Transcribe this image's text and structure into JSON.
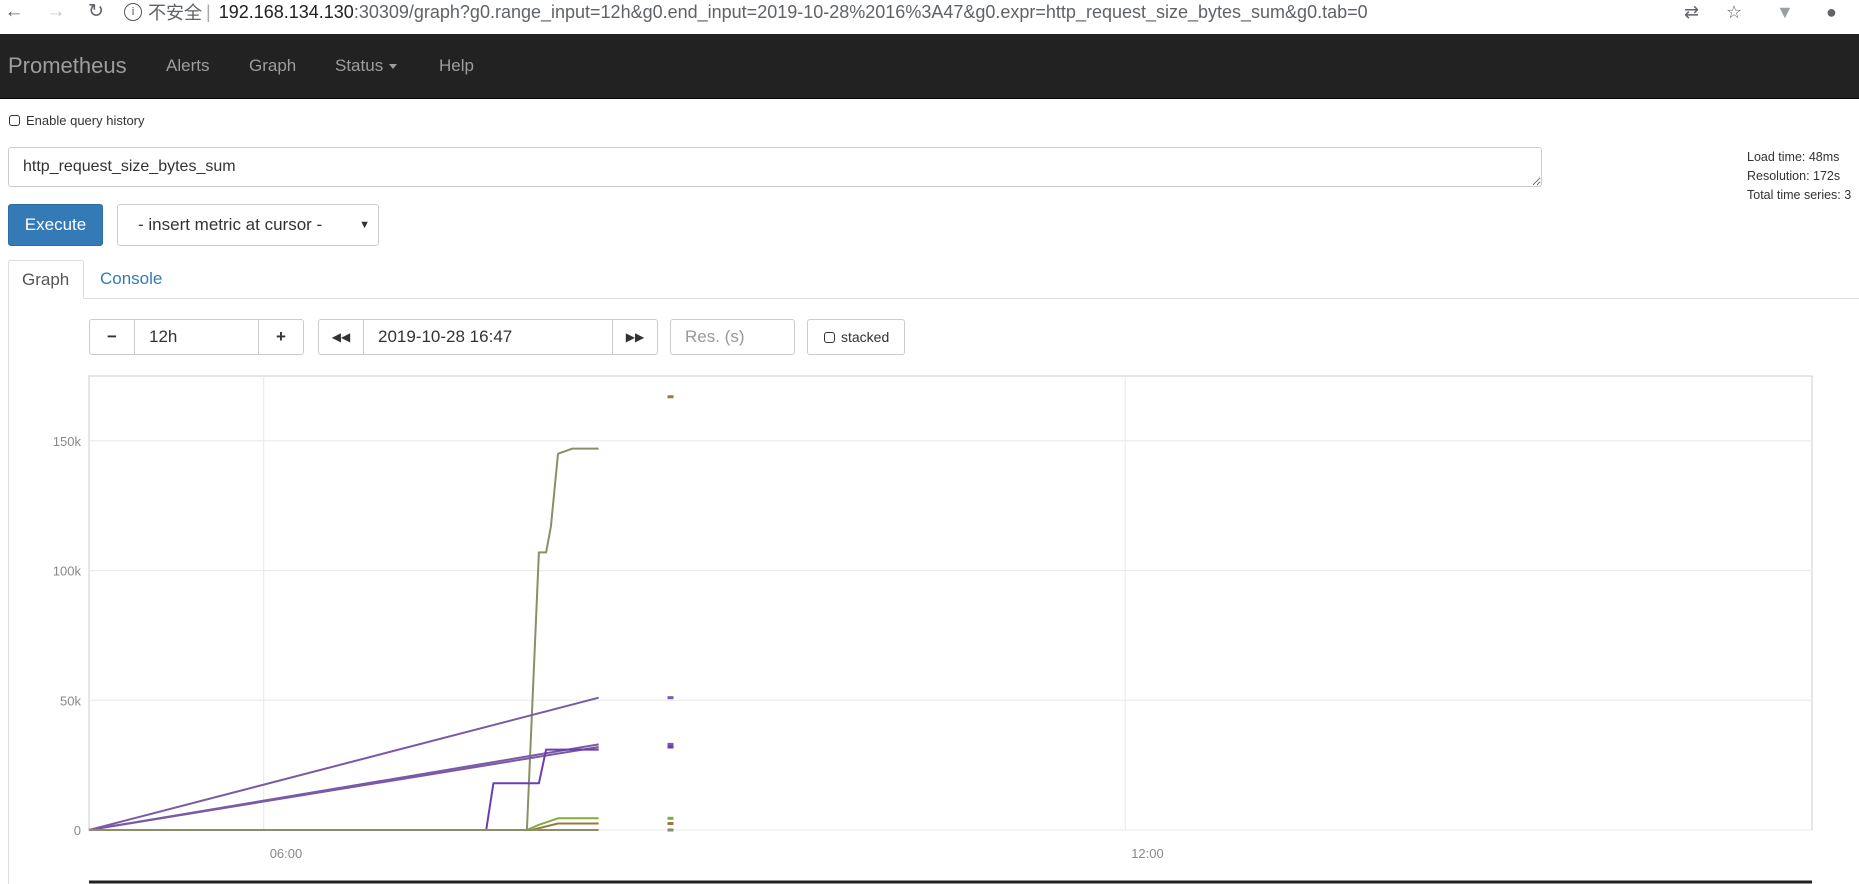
{
  "browser": {
    "back_icon": "arrow-left-icon",
    "forward_icon": "arrow-right-icon",
    "reload_icon": "reload-icon",
    "security_label": "不安全",
    "url_host": "192.168.134.130",
    "url_rest": ":30309/graph?g0.range_input=12h&g0.end_input=2019-10-28%2016%3A47&g0.expr=http_request_size_bytes_sum&g0.tab=0"
  },
  "navbar": {
    "brand": "Prometheus",
    "items": [
      {
        "label": "Alerts"
      },
      {
        "label": "Graph"
      },
      {
        "label": "Status"
      },
      {
        "label": "Help"
      }
    ]
  },
  "query": {
    "history_label": "Enable query history",
    "expression": "http_request_size_bytes_sum",
    "execute_label": "Execute",
    "insert_metric_label": "- insert metric at cursor -"
  },
  "stats": {
    "load_time": "Load time: 48ms",
    "resolution": "Resolution: 172s",
    "total_series": "Total time series: 3"
  },
  "tabs": [
    {
      "label": "Graph",
      "active": true
    },
    {
      "label": "Console",
      "active": false
    }
  ],
  "graph_controls": {
    "minus_label": "−",
    "range_value": "12h",
    "plus_label": "+",
    "back_label": "◀◀",
    "end_time": "2019-10-28 16:47",
    "forward_label": "▶▶",
    "resolution_placeholder": "Res. (s)",
    "stacked_label": "stacked"
  },
  "chart_data": {
    "type": "line",
    "x_type": "time",
    "x_range": [
      "04:47",
      "16:47"
    ],
    "x_ticks": [
      "06:00",
      "12:00"
    ],
    "y_ticks": [
      "0",
      "50k",
      "100k",
      "150k"
    ],
    "ylim": [
      0,
      175000
    ],
    "grid": true,
    "colors": {
      "olive": "#8a8f66",
      "violet": "#7a5aa6",
      "purple": "#6a3db3",
      "green": "#7fae3f",
      "brown": "#9a7a3a"
    },
    "series": [
      {
        "color": "olive",
        "points": [
          [
            "04:47",
            0
          ],
          [
            "07:35",
            0
          ],
          [
            "07:50",
            0
          ],
          [
            "07:55",
            107000
          ],
          [
            "07:58",
            107000
          ],
          [
            "08:00",
            117000
          ],
          [
            "08:03",
            145000
          ],
          [
            "08:06",
            146000
          ],
          [
            "08:09",
            147000
          ],
          [
            "08:20",
            147000
          ]
        ]
      },
      {
        "color": "violet",
        "points": [
          [
            "04:47",
            0
          ],
          [
            "08:20",
            51000
          ]
        ]
      },
      {
        "color": "violet",
        "points": [
          [
            "04:47",
            0
          ],
          [
            "08:20",
            33000
          ]
        ]
      },
      {
        "color": "violet",
        "points": [
          [
            "04:47",
            0
          ],
          [
            "08:20",
            32000
          ]
        ]
      },
      {
        "color": "purple",
        "points": [
          [
            "04:47",
            0
          ],
          [
            "07:33",
            0
          ],
          [
            "07:36",
            18000
          ],
          [
            "07:55",
            18000
          ],
          [
            "07:58",
            31000
          ],
          [
            "08:20",
            31000
          ]
        ]
      },
      {
        "color": "green",
        "points": [
          [
            "04:47",
            0
          ],
          [
            "07:50",
            0
          ],
          [
            "07:55",
            2000
          ],
          [
            "08:03",
            4500
          ],
          [
            "08:20",
            4500
          ]
        ]
      },
      {
        "color": "brown",
        "points": [
          [
            "04:47",
            0
          ],
          [
            "07:52",
            0
          ],
          [
            "08:03",
            2500
          ],
          [
            "08:20",
            2500
          ]
        ]
      },
      {
        "color": "olive",
        "points": [
          [
            "04:47",
            0
          ],
          [
            "08:20",
            0
          ]
        ]
      }
    ],
    "tail_markers": [
      {
        "x": "08:50",
        "y": 167000,
        "color": "brown"
      },
      {
        "x": "08:50",
        "y": 51000,
        "color": "violet"
      },
      {
        "x": "08:50",
        "y": 33000,
        "color": "violet"
      },
      {
        "x": "08:50",
        "y": 32000,
        "color": "purple"
      },
      {
        "x": "08:50",
        "y": 4500,
        "color": "green"
      },
      {
        "x": "08:50",
        "y": 2500,
        "color": "brown"
      },
      {
        "x": "08:50",
        "y": 0,
        "color": "olive"
      }
    ]
  }
}
